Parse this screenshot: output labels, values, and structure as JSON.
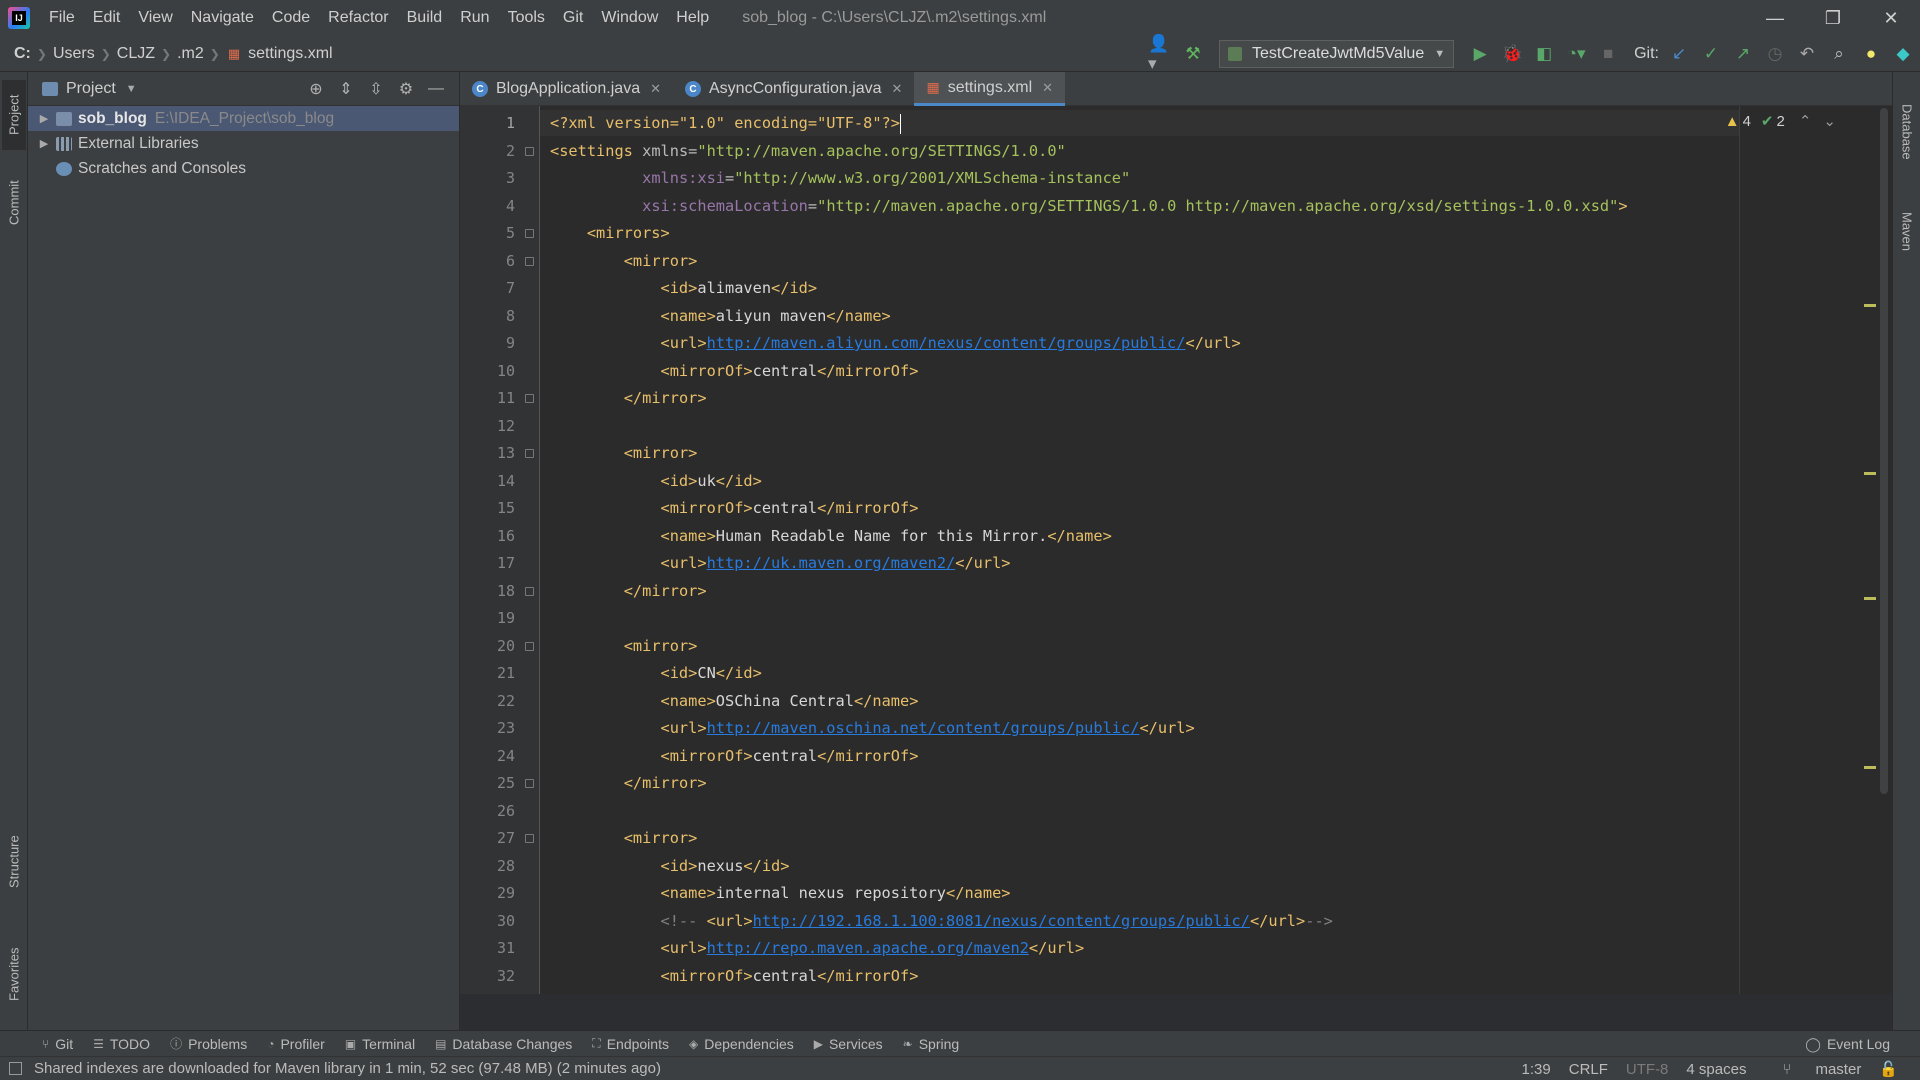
{
  "window": {
    "title": "sob_blog - C:\\Users\\CLJZ\\.m2\\settings.xml",
    "menu": [
      "File",
      "Edit",
      "View",
      "Navigate",
      "Code",
      "Refactor",
      "Build",
      "Run",
      "Tools",
      "Git",
      "Window",
      "Help"
    ],
    "controls": {
      "minimize": "—",
      "restore": "❐",
      "close": "✕"
    }
  },
  "navbar": {
    "breadcrumbs": [
      "C:",
      "Users",
      "CLJZ",
      ".m2",
      "settings.xml"
    ],
    "run_config": "TestCreateJwtMd5Value",
    "git_label": "Git:"
  },
  "left_stripe": {
    "project": "Project",
    "commit": "Commit",
    "structure": "Structure",
    "favorites": "Favorites"
  },
  "right_stripe": {
    "database": "Database",
    "maven": "Maven"
  },
  "project_panel": {
    "title": "Project",
    "tree": [
      {
        "label": "sob_blog",
        "hint": "E:\\IDEA_Project\\sob_blog",
        "selected": true
      },
      {
        "label": "External Libraries",
        "hint": ""
      },
      {
        "label": "Scratches and Consoles",
        "hint": ""
      }
    ]
  },
  "editor_tabs": [
    {
      "label": "BlogApplication.java",
      "icon": "java-class-icon",
      "active": false
    },
    {
      "label": "AsyncConfiguration.java",
      "icon": "java-class-icon",
      "active": false
    },
    {
      "label": "settings.xml",
      "icon": "xml-file-icon",
      "active": true
    }
  ],
  "editor": {
    "current_line": 1,
    "inspections": {
      "warnings": "4",
      "ok": "2"
    },
    "lines": [
      [
        [
          "pi",
          "<?xml version=\"1.0\" encoding=\"UTF-8\"?>"
        ]
      ],
      [
        [
          "tag",
          "<settings "
        ],
        [
          "attr",
          "xmlns="
        ],
        [
          "val",
          "\"http://maven.apache.org/SETTINGS/1.0.0\""
        ]
      ],
      [
        [
          "sp",
          "          "
        ],
        [
          "ns",
          "xmlns:xsi"
        ],
        [
          "attr",
          "="
        ],
        [
          "val",
          "\"http://www.w3.org/2001/XMLSchema-instance\""
        ]
      ],
      [
        [
          "sp",
          "          "
        ],
        [
          "ns",
          "xsi:schemaLocation"
        ],
        [
          "attr",
          "="
        ],
        [
          "val",
          "\"http://maven.apache.org/SETTINGS/1.0.0 http://maven.apache.org/xsd/settings-1.0.0.xsd\""
        ],
        [
          "tag",
          ">"
        ]
      ],
      [
        [
          "sp",
          "    "
        ],
        [
          "tag",
          "<mirrors>"
        ]
      ],
      [
        [
          "sp",
          "        "
        ],
        [
          "tag",
          "<mirror>"
        ]
      ],
      [
        [
          "sp",
          "            "
        ],
        [
          "tag",
          "<id>"
        ],
        [
          "txt",
          "alimaven"
        ],
        [
          "tag",
          "</id>"
        ]
      ],
      [
        [
          "sp",
          "            "
        ],
        [
          "tag",
          "<name>"
        ],
        [
          "txt",
          "aliyun maven"
        ],
        [
          "tag",
          "</name>"
        ]
      ],
      [
        [
          "sp",
          "            "
        ],
        [
          "tag",
          "<url>"
        ],
        [
          "url",
          "http://maven.aliyun.com/nexus/content/groups/public/"
        ],
        [
          "tag",
          "</url>"
        ]
      ],
      [
        [
          "sp",
          "            "
        ],
        [
          "tag",
          "<mirrorOf>"
        ],
        [
          "txt",
          "central"
        ],
        [
          "tag",
          "</mirrorOf>"
        ]
      ],
      [
        [
          "sp",
          "        "
        ],
        [
          "tag",
          "</mirror>"
        ]
      ],
      [],
      [
        [
          "sp",
          "        "
        ],
        [
          "tag",
          "<mirror>"
        ]
      ],
      [
        [
          "sp",
          "            "
        ],
        [
          "tag",
          "<id>"
        ],
        [
          "txt",
          "uk"
        ],
        [
          "tag",
          "</id>"
        ]
      ],
      [
        [
          "sp",
          "            "
        ],
        [
          "tag",
          "<mirrorOf>"
        ],
        [
          "txt",
          "central"
        ],
        [
          "tag",
          "</mirrorOf>"
        ]
      ],
      [
        [
          "sp",
          "            "
        ],
        [
          "tag",
          "<name>"
        ],
        [
          "txt",
          "Human Readable Name for this Mirror."
        ],
        [
          "tag",
          "</name>"
        ]
      ],
      [
        [
          "sp",
          "            "
        ],
        [
          "tag",
          "<url>"
        ],
        [
          "url",
          "http://uk.maven.org/maven2/"
        ],
        [
          "tag",
          "</url>"
        ]
      ],
      [
        [
          "sp",
          "        "
        ],
        [
          "tag",
          "</mirror>"
        ]
      ],
      [],
      [
        [
          "sp",
          "        "
        ],
        [
          "tag",
          "<mirror>"
        ]
      ],
      [
        [
          "sp",
          "            "
        ],
        [
          "tag",
          "<id>"
        ],
        [
          "txt",
          "CN"
        ],
        [
          "tag",
          "</id>"
        ]
      ],
      [
        [
          "sp",
          "            "
        ],
        [
          "tag",
          "<name>"
        ],
        [
          "txt",
          "OSChina Central"
        ],
        [
          "tag",
          "</name>"
        ]
      ],
      [
        [
          "sp",
          "            "
        ],
        [
          "tag",
          "<url>"
        ],
        [
          "url",
          "http://maven.oschina.net/content/groups/public/"
        ],
        [
          "tag",
          "</url>"
        ]
      ],
      [
        [
          "sp",
          "            "
        ],
        [
          "tag",
          "<mirrorOf>"
        ],
        [
          "txt",
          "central"
        ],
        [
          "tag",
          "</mirrorOf>"
        ]
      ],
      [
        [
          "sp",
          "        "
        ],
        [
          "tag",
          "</mirror>"
        ]
      ],
      [],
      [
        [
          "sp",
          "        "
        ],
        [
          "tag",
          "<mirror>"
        ]
      ],
      [
        [
          "sp",
          "            "
        ],
        [
          "tag",
          "<id>"
        ],
        [
          "txt",
          "nexus"
        ],
        [
          "tag",
          "</id>"
        ]
      ],
      [
        [
          "sp",
          "            "
        ],
        [
          "tag",
          "<name>"
        ],
        [
          "txt",
          "internal nexus repository"
        ],
        [
          "tag",
          "</name>"
        ]
      ],
      [
        [
          "sp",
          "            "
        ],
        [
          "com",
          "<!-- "
        ],
        [
          "tag",
          "<url>"
        ],
        [
          "url",
          "http://192.168.1.100:8081/nexus/content/groups/public/"
        ],
        [
          "tag",
          "</url>"
        ],
        [
          "com",
          "-->"
        ]
      ],
      [
        [
          "sp",
          "            "
        ],
        [
          "tag",
          "<url>"
        ],
        [
          "url",
          "http://repo.maven.apache.org/maven2"
        ],
        [
          "tag",
          "</url>"
        ]
      ],
      [
        [
          "sp",
          "            "
        ],
        [
          "tag",
          "<mirrorOf>"
        ],
        [
          "txt",
          "central"
        ],
        [
          "tag",
          "</mirrorOf>"
        ]
      ]
    ],
    "fold_lines": [
      2,
      5,
      6,
      11,
      13,
      18,
      20,
      25,
      27
    ]
  },
  "tool_windows": [
    {
      "label": "Git",
      "icon": "git-branch-icon"
    },
    {
      "label": "TODO",
      "icon": "list-icon"
    },
    {
      "label": "Problems",
      "icon": "info-icon"
    },
    {
      "label": "Profiler",
      "icon": "profiler-icon"
    },
    {
      "label": "Terminal",
      "icon": "terminal-icon"
    },
    {
      "label": "Database Changes",
      "icon": "database-icon"
    },
    {
      "label": "Endpoints",
      "icon": "endpoints-icon"
    },
    {
      "label": "Dependencies",
      "icon": "dependencies-icon"
    },
    {
      "label": "Services",
      "icon": "services-icon"
    },
    {
      "label": "Spring",
      "icon": "spring-icon"
    }
  ],
  "event_log": "Event Log",
  "status": {
    "message": "Shared indexes are downloaded for Maven library in 1 min, 52 sec (97.48 MB) (2 minutes ago)",
    "position": "1:39",
    "line_sep": "CRLF",
    "encoding": "UTF-8",
    "indent": "4 spaces",
    "branch": "master"
  },
  "colors": {
    "tag": "#e8bf6a",
    "value": "#a5c25c",
    "url": "#287bde",
    "selection": "#4b5874",
    "accent": "#4a88c7"
  }
}
